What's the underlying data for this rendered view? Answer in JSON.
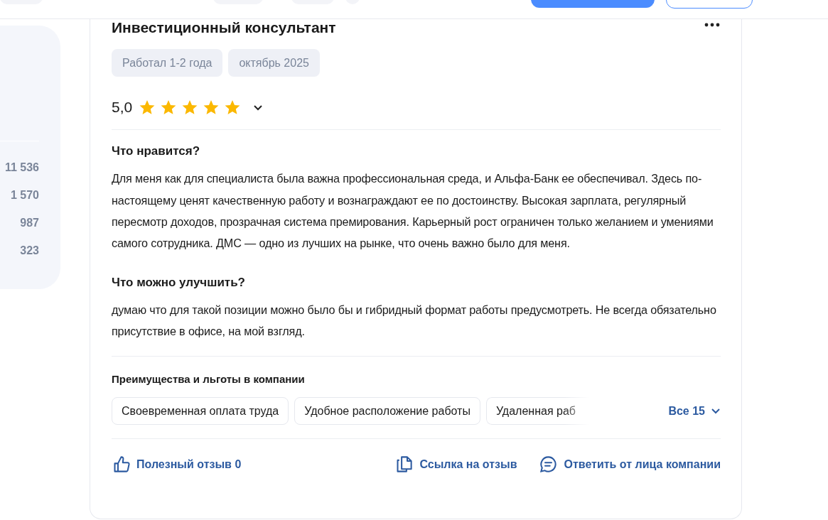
{
  "sidebar": {
    "counts": [
      "11 536",
      "1 570",
      "987",
      "323"
    ]
  },
  "review": {
    "title": "Инвестиционный консультант",
    "tags": [
      "Работал 1-2 года",
      "октябрь 2025"
    ],
    "rating": "5,0",
    "stars": 5,
    "sections": [
      {
        "heading": "Что нравится?",
        "text": "Для меня как для специалиста была важна профессиональная среда, и Альфа-Банк ее обеспечивал. Здесь по-настоящему ценят качественную работу и вознаграждают ее по достоинству. Высокая зарплата, регулярный пересмотр доходов, прозрачная система премирования. Карьерный рост ограничен только желанием и умениями самого сотрудника. ДМС — одно из лучших на рынке, что очень важно было для меня."
      },
      {
        "heading": "Что можно улучшить?",
        "text": "думаю что для такой позиции можно было бы и гибридный формат работы предусмотреть. Не всегда обязательно присутствие в офисе, на мой взгляд."
      }
    ],
    "benefits": {
      "heading": "Преимущества и льготы в компании",
      "chips": [
        {
          "label": "Своевременная оплата труда",
          "faded": false
        },
        {
          "label": "Удобное расположение работы",
          "faded": false
        },
        {
          "label": "Удаленная раб",
          "faded": true
        }
      ],
      "more": "Все 15"
    },
    "actions": [
      {
        "kind": "like",
        "label": "Полезный отзыв 0"
      },
      {
        "kind": "link",
        "label": "Ссылка на отзыв"
      },
      {
        "kind": "reply",
        "label": "Ответить от лица компании"
      }
    ]
  }
}
